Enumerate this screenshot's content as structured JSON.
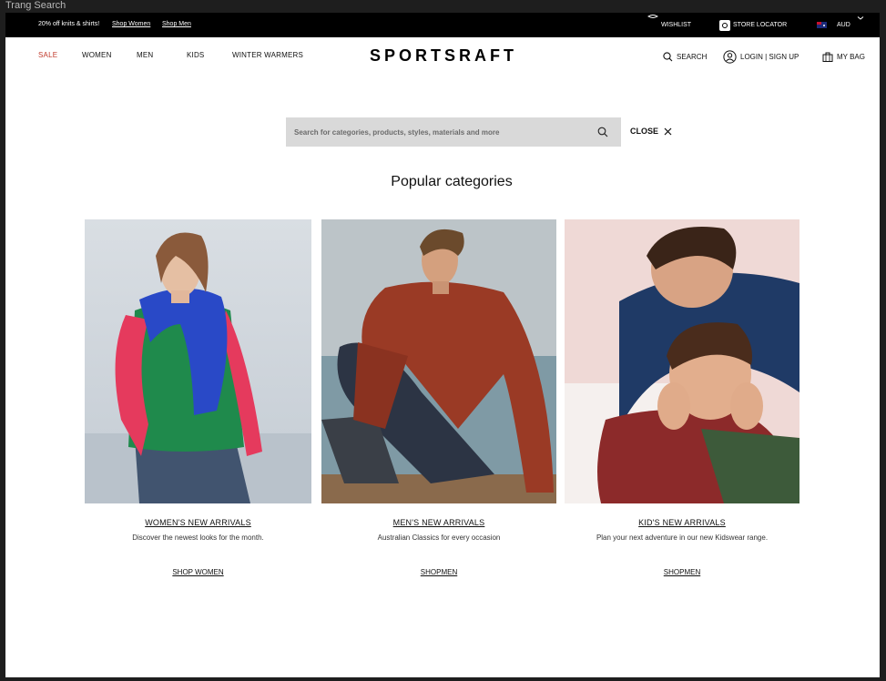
{
  "window": {
    "title": "Trang Search"
  },
  "promo": {
    "text": "20% off knits & shirts!",
    "shop_women": "Shop Women",
    "shop_men": "Shop Men"
  },
  "utility": {
    "wishlist": "WISHLIST",
    "store_locator": "STORE LOCATOR",
    "currency": "AUD"
  },
  "nav": {
    "items": [
      {
        "label": "SALE"
      },
      {
        "label": "WOMEN"
      },
      {
        "label": "MEN"
      },
      {
        "label": "KIDS"
      },
      {
        "label": "WINTER WARMERS"
      }
    ]
  },
  "brand": {
    "logo": "SPORTSRAFT"
  },
  "header_actions": {
    "search": "SEARCH",
    "login": "LOGIN | SIGN UP",
    "bag": "MY BAG"
  },
  "search": {
    "placeholder": "Search for categories, products, styles, materials and more",
    "value": "",
    "close_label": "CLOSE"
  },
  "popular": {
    "heading": "Popular categories",
    "cards": [
      {
        "title": "WOMEN'S NEW ARRIVALS",
        "description": "Discover the newest looks for the month.",
        "cta": "SHOP WOMEN"
      },
      {
        "title": "MEN'S NEW ARRIVALS",
        "description": "Australian Classics for every occasion",
        "cta": "SHOPMEN"
      },
      {
        "title": "KID'S NEW ARRIVALS",
        "description": "Plan your next adventure in our new Kidswear range.",
        "cta": "SHOPMEN"
      }
    ]
  },
  "colors": {
    "sale_red": "#c0392b",
    "promo_bg": "#000000",
    "search_bg": "#d9d9d9"
  }
}
